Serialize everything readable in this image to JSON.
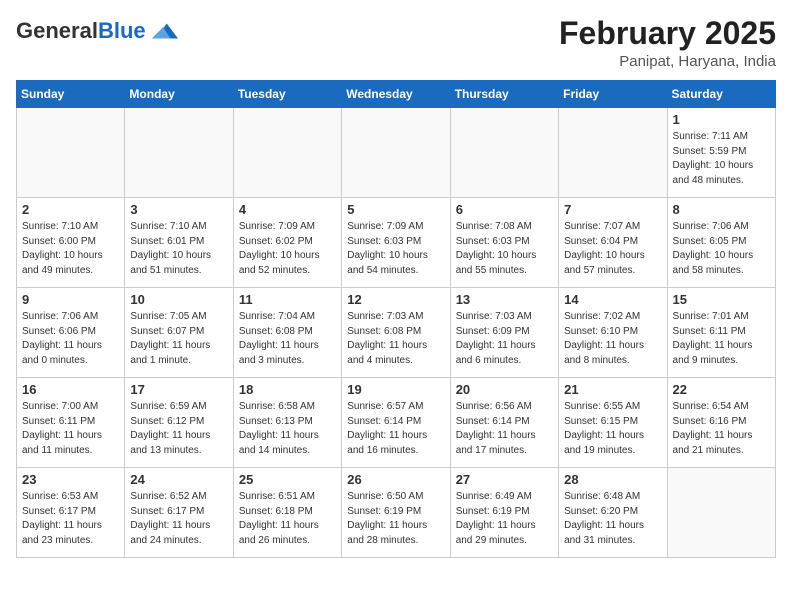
{
  "header": {
    "logo_general": "General",
    "logo_blue": "Blue",
    "title": "February 2025",
    "subtitle": "Panipat, Haryana, India"
  },
  "weekdays": [
    "Sunday",
    "Monday",
    "Tuesday",
    "Wednesday",
    "Thursday",
    "Friday",
    "Saturday"
  ],
  "weeks": [
    [
      {
        "day": "",
        "info": ""
      },
      {
        "day": "",
        "info": ""
      },
      {
        "day": "",
        "info": ""
      },
      {
        "day": "",
        "info": ""
      },
      {
        "day": "",
        "info": ""
      },
      {
        "day": "",
        "info": ""
      },
      {
        "day": "1",
        "info": "Sunrise: 7:11 AM\nSunset: 5:59 PM\nDaylight: 10 hours and 48 minutes."
      }
    ],
    [
      {
        "day": "2",
        "info": "Sunrise: 7:10 AM\nSunset: 6:00 PM\nDaylight: 10 hours and 49 minutes."
      },
      {
        "day": "3",
        "info": "Sunrise: 7:10 AM\nSunset: 6:01 PM\nDaylight: 10 hours and 51 minutes."
      },
      {
        "day": "4",
        "info": "Sunrise: 7:09 AM\nSunset: 6:02 PM\nDaylight: 10 hours and 52 minutes."
      },
      {
        "day": "5",
        "info": "Sunrise: 7:09 AM\nSunset: 6:03 PM\nDaylight: 10 hours and 54 minutes."
      },
      {
        "day": "6",
        "info": "Sunrise: 7:08 AM\nSunset: 6:03 PM\nDaylight: 10 hours and 55 minutes."
      },
      {
        "day": "7",
        "info": "Sunrise: 7:07 AM\nSunset: 6:04 PM\nDaylight: 10 hours and 57 minutes."
      },
      {
        "day": "8",
        "info": "Sunrise: 7:06 AM\nSunset: 6:05 PM\nDaylight: 10 hours and 58 minutes."
      }
    ],
    [
      {
        "day": "9",
        "info": "Sunrise: 7:06 AM\nSunset: 6:06 PM\nDaylight: 11 hours and 0 minutes."
      },
      {
        "day": "10",
        "info": "Sunrise: 7:05 AM\nSunset: 6:07 PM\nDaylight: 11 hours and 1 minute."
      },
      {
        "day": "11",
        "info": "Sunrise: 7:04 AM\nSunset: 6:08 PM\nDaylight: 11 hours and 3 minutes."
      },
      {
        "day": "12",
        "info": "Sunrise: 7:03 AM\nSunset: 6:08 PM\nDaylight: 11 hours and 4 minutes."
      },
      {
        "day": "13",
        "info": "Sunrise: 7:03 AM\nSunset: 6:09 PM\nDaylight: 11 hours and 6 minutes."
      },
      {
        "day": "14",
        "info": "Sunrise: 7:02 AM\nSunset: 6:10 PM\nDaylight: 11 hours and 8 minutes."
      },
      {
        "day": "15",
        "info": "Sunrise: 7:01 AM\nSunset: 6:11 PM\nDaylight: 11 hours and 9 minutes."
      }
    ],
    [
      {
        "day": "16",
        "info": "Sunrise: 7:00 AM\nSunset: 6:11 PM\nDaylight: 11 hours and 11 minutes."
      },
      {
        "day": "17",
        "info": "Sunrise: 6:59 AM\nSunset: 6:12 PM\nDaylight: 11 hours and 13 minutes."
      },
      {
        "day": "18",
        "info": "Sunrise: 6:58 AM\nSunset: 6:13 PM\nDaylight: 11 hours and 14 minutes."
      },
      {
        "day": "19",
        "info": "Sunrise: 6:57 AM\nSunset: 6:14 PM\nDaylight: 11 hours and 16 minutes."
      },
      {
        "day": "20",
        "info": "Sunrise: 6:56 AM\nSunset: 6:14 PM\nDaylight: 11 hours and 17 minutes."
      },
      {
        "day": "21",
        "info": "Sunrise: 6:55 AM\nSunset: 6:15 PM\nDaylight: 11 hours and 19 minutes."
      },
      {
        "day": "22",
        "info": "Sunrise: 6:54 AM\nSunset: 6:16 PM\nDaylight: 11 hours and 21 minutes."
      }
    ],
    [
      {
        "day": "23",
        "info": "Sunrise: 6:53 AM\nSunset: 6:17 PM\nDaylight: 11 hours and 23 minutes."
      },
      {
        "day": "24",
        "info": "Sunrise: 6:52 AM\nSunset: 6:17 PM\nDaylight: 11 hours and 24 minutes."
      },
      {
        "day": "25",
        "info": "Sunrise: 6:51 AM\nSunset: 6:18 PM\nDaylight: 11 hours and 26 minutes."
      },
      {
        "day": "26",
        "info": "Sunrise: 6:50 AM\nSunset: 6:19 PM\nDaylight: 11 hours and 28 minutes."
      },
      {
        "day": "27",
        "info": "Sunrise: 6:49 AM\nSunset: 6:19 PM\nDaylight: 11 hours and 29 minutes."
      },
      {
        "day": "28",
        "info": "Sunrise: 6:48 AM\nSunset: 6:20 PM\nDaylight: 11 hours and 31 minutes."
      },
      {
        "day": "",
        "info": ""
      }
    ]
  ]
}
